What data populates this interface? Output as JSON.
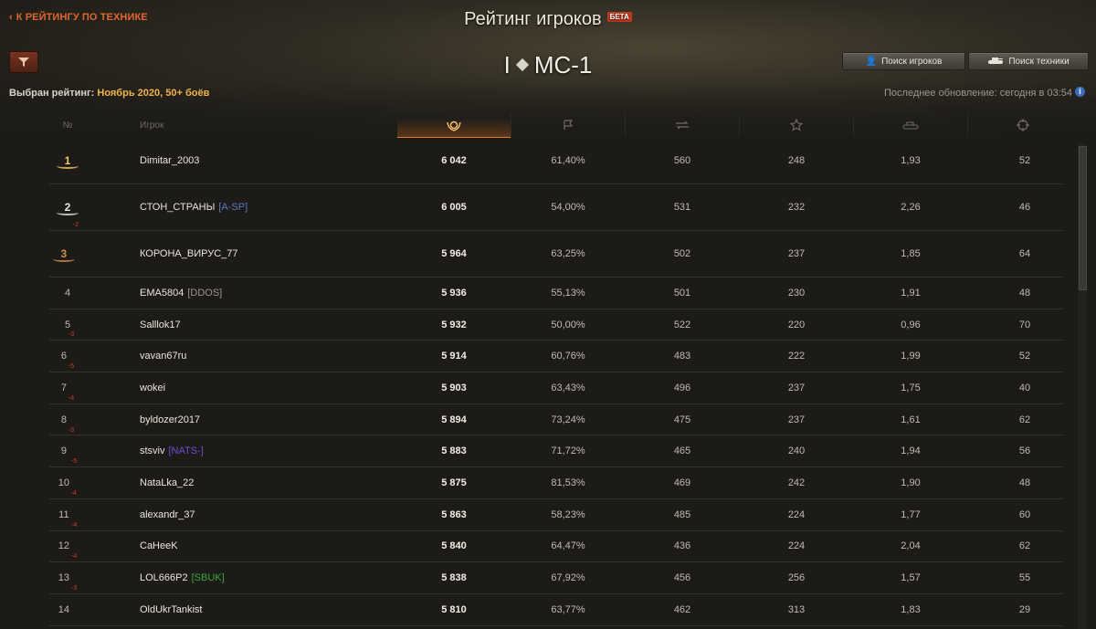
{
  "header": {
    "back_link": "К РЕЙТИНГУ ПО ТЕХНИКЕ",
    "title": "Рейтинг игроков",
    "beta": "БЕТА",
    "tank_tier": "I",
    "tank_name": "МС-1",
    "search_players": "Поиск игроков",
    "search_vehicles": "Поиск техники",
    "selected_label": "Выбран рейтинг:",
    "selected_value": "Ноябрь 2020, 50+ боёв",
    "last_update": "Последнее обновление: сегодня в 03:54",
    "info": "i"
  },
  "columns": {
    "rank": "№",
    "player": "Игрок",
    "icons": [
      "wreath-icon",
      "flag-icon",
      "battles-icon",
      "star-icon",
      "tank-damage-icon",
      "target-icon"
    ]
  },
  "colors": {
    "accent": "#e0662e",
    "gold": "#f3c565",
    "delta": "#d23a2a",
    "clan_blue": "#5b7ab8",
    "clan_purple": "#6b4bd6",
    "clan_green": "#3fa63b",
    "clan_gray": "#9a978c"
  },
  "rows": [
    {
      "rank": "1",
      "medal": "gold",
      "delta": "",
      "nick": "Dimitar_2003",
      "clan": "",
      "clan_color": "",
      "score": "6 042",
      "winrate": "61,40%",
      "c3": "560",
      "c4": "248",
      "c5": "1,93",
      "c6": "52"
    },
    {
      "rank": "2",
      "medal": "silver",
      "delta": "",
      "nick": "СТОН_СТРАНЫ",
      "clan": "[A-SP]",
      "clan_color": "#5b7ab8",
      "score": "6 005",
      "winrate": "54,00%",
      "c3": "531",
      "c4": "232",
      "c5": "2,26",
      "c6": "46"
    },
    {
      "rank": "3",
      "medal": "bronze",
      "delta": "-2",
      "nick": "КОРОНА_ВИРУС_77",
      "clan": "",
      "clan_color": "",
      "score": "5 964",
      "winrate": "63,25%",
      "c3": "502",
      "c4": "237",
      "c5": "1,85",
      "c6": "64"
    },
    {
      "rank": "4",
      "medal": "",
      "delta": "",
      "nick": "EMA5804",
      "clan": "[DDOS]",
      "clan_color": "#9a978c",
      "score": "5 936",
      "winrate": "55,13%",
      "c3": "501",
      "c4": "230",
      "c5": "1,91",
      "c6": "48"
    },
    {
      "rank": "5",
      "medal": "",
      "delta": "",
      "nick": "Salllok17",
      "clan": "",
      "clan_color": "",
      "score": "5 932",
      "winrate": "50,00%",
      "c3": "522",
      "c4": "220",
      "c5": "0,96",
      "c6": "70"
    },
    {
      "rank": "6",
      "medal": "",
      "delta": "-3",
      "nick": "vavan67ru",
      "clan": "",
      "clan_color": "",
      "score": "5 914",
      "winrate": "60,76%",
      "c3": "483",
      "c4": "222",
      "c5": "1,99",
      "c6": "52"
    },
    {
      "rank": "7",
      "medal": "",
      "delta": "-5",
      "nick": "wokei",
      "clan": "",
      "clan_color": "",
      "score": "5 903",
      "winrate": "63,43%",
      "c3": "496",
      "c4": "237",
      "c5": "1,75",
      "c6": "40"
    },
    {
      "rank": "8",
      "medal": "",
      "delta": "-4",
      "nick": "byldozer2017",
      "clan": "",
      "clan_color": "",
      "score": "5 894",
      "winrate": "73,24%",
      "c3": "475",
      "c4": "237",
      "c5": "1,61",
      "c6": "62"
    },
    {
      "rank": "9",
      "medal": "",
      "delta": "-3",
      "nick": "stsviv",
      "clan": "[NATS-]",
      "clan_color": "#6b4bd6",
      "score": "5 883",
      "winrate": "71,72%",
      "c3": "465",
      "c4": "240",
      "c5": "1,94",
      "c6": "56"
    },
    {
      "rank": "10",
      "medal": "",
      "delta": "-5",
      "nick": "NataLka_22",
      "clan": "",
      "clan_color": "",
      "score": "5 875",
      "winrate": "81,53%",
      "c3": "469",
      "c4": "242",
      "c5": "1,90",
      "c6": "48"
    },
    {
      "rank": "11",
      "medal": "",
      "delta": "-4",
      "nick": "alexandr_37",
      "clan": "",
      "clan_color": "",
      "score": "5 863",
      "winrate": "58,23%",
      "c3": "485",
      "c4": "224",
      "c5": "1,77",
      "c6": "60"
    },
    {
      "rank": "12",
      "medal": "",
      "delta": "-4",
      "nick": "CaHeeK",
      "clan": "",
      "clan_color": "",
      "score": "5 840",
      "winrate": "64,47%",
      "c3": "436",
      "c4": "224",
      "c5": "2,04",
      "c6": "62"
    },
    {
      "rank": "13",
      "medal": "",
      "delta": "-4",
      "nick": "LOL666P2",
      "clan": "[SBUK]",
      "clan_color": "#3fa63b",
      "score": "5 838",
      "winrate": "67,92%",
      "c3": "456",
      "c4": "256",
      "c5": "1,57",
      "c6": "55"
    },
    {
      "rank": "14",
      "medal": "",
      "delta": "-3",
      "nick": "OldUkrTankist",
      "clan": "",
      "clan_color": "",
      "score": "5 810",
      "winrate": "63,77%",
      "c3": "462",
      "c4": "313",
      "c5": "1,83",
      "c6": "29"
    }
  ]
}
